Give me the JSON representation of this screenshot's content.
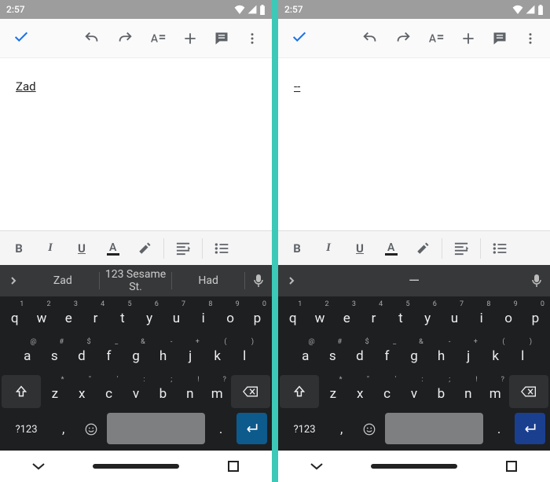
{
  "status": {
    "time": "2:57"
  },
  "left": {
    "doc_text": "Zad",
    "suggestions": {
      "s1": "Zad",
      "s2": "123 Sesame St.",
      "s3": "Had"
    }
  },
  "right": {
    "doc_text": "--",
    "suggestion_center": "—"
  },
  "format": {
    "bold": "B",
    "italic": "I",
    "underline": "U",
    "textcolor": "A"
  },
  "keyboard": {
    "row1": [
      {
        "k": "q",
        "sup": "1"
      },
      {
        "k": "w",
        "sup": "2"
      },
      {
        "k": "e",
        "sup": "3"
      },
      {
        "k": "r",
        "sup": "4"
      },
      {
        "k": "t",
        "sup": "5"
      },
      {
        "k": "y",
        "sup": "6"
      },
      {
        "k": "u",
        "sup": "7"
      },
      {
        "k": "i",
        "sup": "8"
      },
      {
        "k": "o",
        "sup": "9"
      },
      {
        "k": "p",
        "sup": "0"
      }
    ],
    "row2": [
      {
        "k": "a",
        "sup": "@"
      },
      {
        "k": "s",
        "sup": "#"
      },
      {
        "k": "d",
        "sup": "$"
      },
      {
        "k": "f",
        "sup": "_"
      },
      {
        "k": "g",
        "sup": "&"
      },
      {
        "k": "h",
        "sup": "-"
      },
      {
        "k": "j",
        "sup": "+"
      },
      {
        "k": "k",
        "sup": "("
      },
      {
        "k": "l",
        "sup": ")"
      }
    ],
    "row3": [
      {
        "k": "z",
        "sup": "*"
      },
      {
        "k": "x",
        "sup": "\""
      },
      {
        "k": "c",
        "sup": "'"
      },
      {
        "k": "v",
        "sup": ":"
      },
      {
        "k": "b",
        "sup": ";"
      },
      {
        "k": "n",
        "sup": "!"
      },
      {
        "k": "m",
        "sup": "?"
      }
    ],
    "sym": "?123",
    "comma": ",",
    "period": "."
  }
}
